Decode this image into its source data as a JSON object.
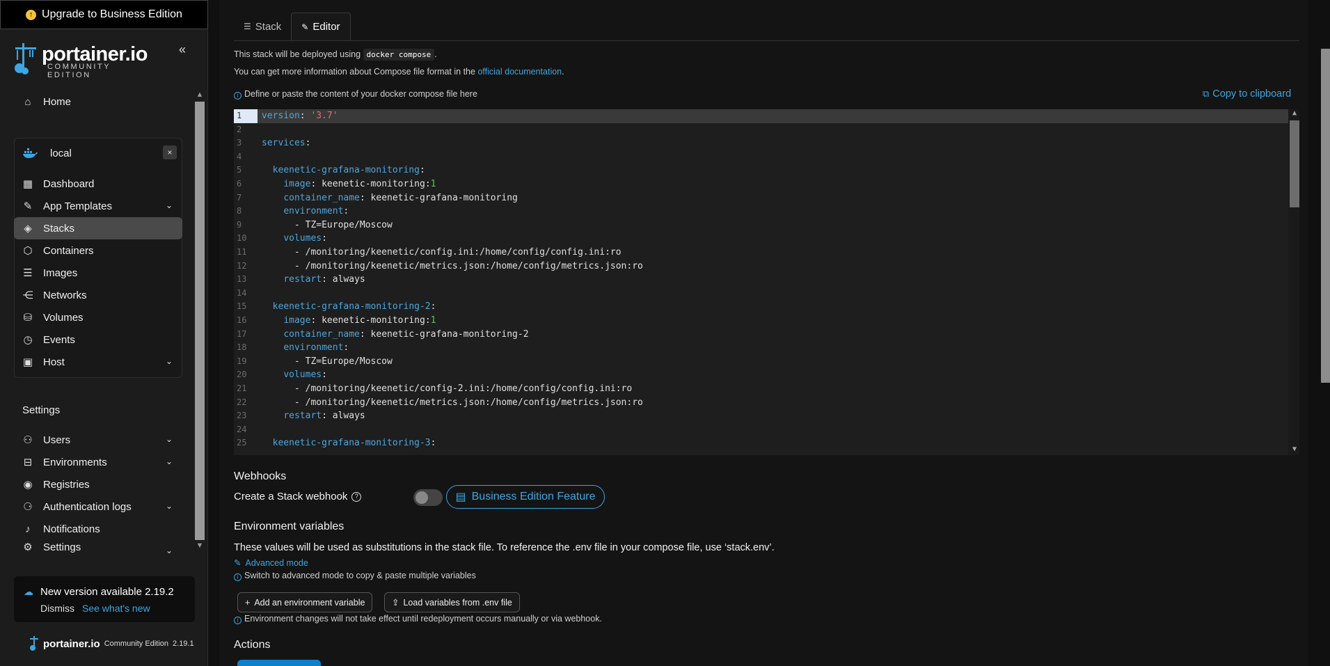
{
  "sidebar": {
    "upgrade_label": "Upgrade to Business Edition",
    "logo_name": "portainer.io",
    "logo_edition": "COMMUNITY EDITION",
    "collapse_glyph": "«",
    "home_label": "Home",
    "environment": {
      "name": "local",
      "close_glyph": "×",
      "items": [
        {
          "label": "Dashboard",
          "icon": "dashboard-icon",
          "glyph": "▦",
          "chevron": false
        },
        {
          "label": "App Templates",
          "icon": "edit-icon",
          "glyph": "✎",
          "chevron": true
        },
        {
          "label": "Stacks",
          "icon": "layers-icon",
          "glyph": "◈",
          "chevron": false,
          "active": true
        },
        {
          "label": "Containers",
          "icon": "box-icon",
          "glyph": "⬡",
          "chevron": false
        },
        {
          "label": "Images",
          "icon": "list-icon",
          "glyph": "☰",
          "chevron": false
        },
        {
          "label": "Networks",
          "icon": "share-icon",
          "glyph": "⋲",
          "chevron": false
        },
        {
          "label": "Volumes",
          "icon": "database-icon",
          "glyph": "⛁",
          "chevron": false
        },
        {
          "label": "Events",
          "icon": "clock-icon",
          "glyph": "◷",
          "chevron": false
        },
        {
          "label": "Host",
          "icon": "server-icon",
          "glyph": "▣",
          "chevron": true
        }
      ]
    },
    "settings_title": "Settings",
    "settings_items": [
      {
        "label": "Users",
        "icon": "users-icon",
        "glyph": "⚇",
        "chevron": true
      },
      {
        "label": "Environments",
        "icon": "hard-drive-icon",
        "glyph": "⊟",
        "chevron": true
      },
      {
        "label": "Registries",
        "icon": "radio-icon",
        "glyph": "◉",
        "chevron": false
      },
      {
        "label": "Authentication logs",
        "icon": "user-clock-icon",
        "glyph": "⚆",
        "chevron": true
      },
      {
        "label": "Notifications",
        "icon": "bell-icon",
        "glyph": "♪",
        "chevron": false
      },
      {
        "label": "Settings",
        "icon": "gear-icon",
        "glyph": "⚙",
        "chevron": true
      }
    ],
    "update": {
      "title": "New version available 2.19.2",
      "dismiss": "Dismiss",
      "whats_new": "See what's new"
    },
    "footer": {
      "name": "portainer.io",
      "edition": "Community Edition",
      "version": "2.19.1"
    }
  },
  "main": {
    "tabs": [
      {
        "label": "Stack",
        "icon": "list-icon",
        "glyph": "☰",
        "active": false
      },
      {
        "label": "Editor",
        "icon": "edit-icon",
        "glyph": "✎",
        "active": true
      }
    ],
    "deploy_prefix": "This stack will be deployed using",
    "deploy_tool": "docker compose",
    "deploy_suffix": ".",
    "docs_prefix": "You can get more information about Compose file format in the",
    "docs_link": "official documentation",
    "docs_suffix": ".",
    "define_hint": "Define or paste the content of your docker compose file here",
    "copy_label": "Copy to clipboard",
    "editor_lines": [
      [
        [
          "k",
          "version"
        ],
        [
          "p",
          ": "
        ],
        [
          "s",
          "'3.7'"
        ]
      ],
      [],
      [
        [
          "k",
          "services"
        ],
        [
          "p",
          ":"
        ]
      ],
      [],
      [
        [
          "p",
          "  "
        ],
        [
          "k",
          "keenetic-grafana-monitoring"
        ],
        [
          "p",
          ":"
        ]
      ],
      [
        [
          "p",
          "    "
        ],
        [
          "k",
          "image"
        ],
        [
          "p",
          ": keenetic-monitoring:"
        ],
        [
          "n",
          "1"
        ]
      ],
      [
        [
          "p",
          "    "
        ],
        [
          "k",
          "container_name"
        ],
        [
          "p",
          ": keenetic-grafana-monitoring"
        ]
      ],
      [
        [
          "p",
          "    "
        ],
        [
          "k",
          "environment"
        ],
        [
          "p",
          ":"
        ]
      ],
      [
        [
          "p",
          "      - TZ=Europe/Moscow"
        ]
      ],
      [
        [
          "p",
          "    "
        ],
        [
          "k",
          "volumes"
        ],
        [
          "p",
          ":"
        ]
      ],
      [
        [
          "p",
          "      - /monitoring/keenetic/config.ini:/home/config/config.ini:ro"
        ]
      ],
      [
        [
          "p",
          "      - /monitoring/keenetic/metrics.json:/home/config/metrics.json:ro"
        ]
      ],
      [
        [
          "p",
          "    "
        ],
        [
          "k",
          "restart"
        ],
        [
          "p",
          ": always"
        ]
      ],
      [],
      [
        [
          "p",
          "  "
        ],
        [
          "k",
          "keenetic-grafana-monitoring-2"
        ],
        [
          "p",
          ":"
        ]
      ],
      [
        [
          "p",
          "    "
        ],
        [
          "k",
          "image"
        ],
        [
          "p",
          ": keenetic-monitoring:"
        ],
        [
          "n",
          "1"
        ]
      ],
      [
        [
          "p",
          "    "
        ],
        [
          "k",
          "container_name"
        ],
        [
          "p",
          ": keenetic-grafana-monitoring-2"
        ]
      ],
      [
        [
          "p",
          "    "
        ],
        [
          "k",
          "environment"
        ],
        [
          "p",
          ":"
        ]
      ],
      [
        [
          "p",
          "      - TZ=Europe/Moscow"
        ]
      ],
      [
        [
          "p",
          "    "
        ],
        [
          "k",
          "volumes"
        ],
        [
          "p",
          ":"
        ]
      ],
      [
        [
          "p",
          "      - /monitoring/keenetic/config-2.ini:/home/config/config.ini:ro"
        ]
      ],
      [
        [
          "p",
          "      - /monitoring/keenetic/metrics.json:/home/config/metrics.json:ro"
        ]
      ],
      [
        [
          "p",
          "    "
        ],
        [
          "k",
          "restart"
        ],
        [
          "p",
          ": always"
        ]
      ],
      [],
      [
        [
          "p",
          "  "
        ],
        [
          "k",
          "keenetic-grafana-monitoring-3"
        ],
        [
          "p",
          ":"
        ]
      ]
    ],
    "current_line": 1,
    "webhooks_title": "Webhooks",
    "webhook_label": "Create a Stack webhook",
    "be_feature": "Business Edition Feature",
    "env_vars_title": "Environment variables",
    "env_vars_desc": "These values will be used as substitutions in the stack file. To reference the .env file in your compose file, use ‘stack.env’.",
    "advanced_mode": "Advanced mode",
    "switch_hint": "Switch to advanced mode to copy & paste multiple variables",
    "add_env_btn": "Add an environment variable",
    "load_env_btn": "Load variables from .env file",
    "env_hint": "Environment changes will not take effect until redeployment occurs manually or via webhook.",
    "actions_title": "Actions"
  },
  "colors": {
    "accent": "#3ea6e0",
    "keyword": "#4ea6dc",
    "string": "#e06c75",
    "number": "#57c557"
  }
}
